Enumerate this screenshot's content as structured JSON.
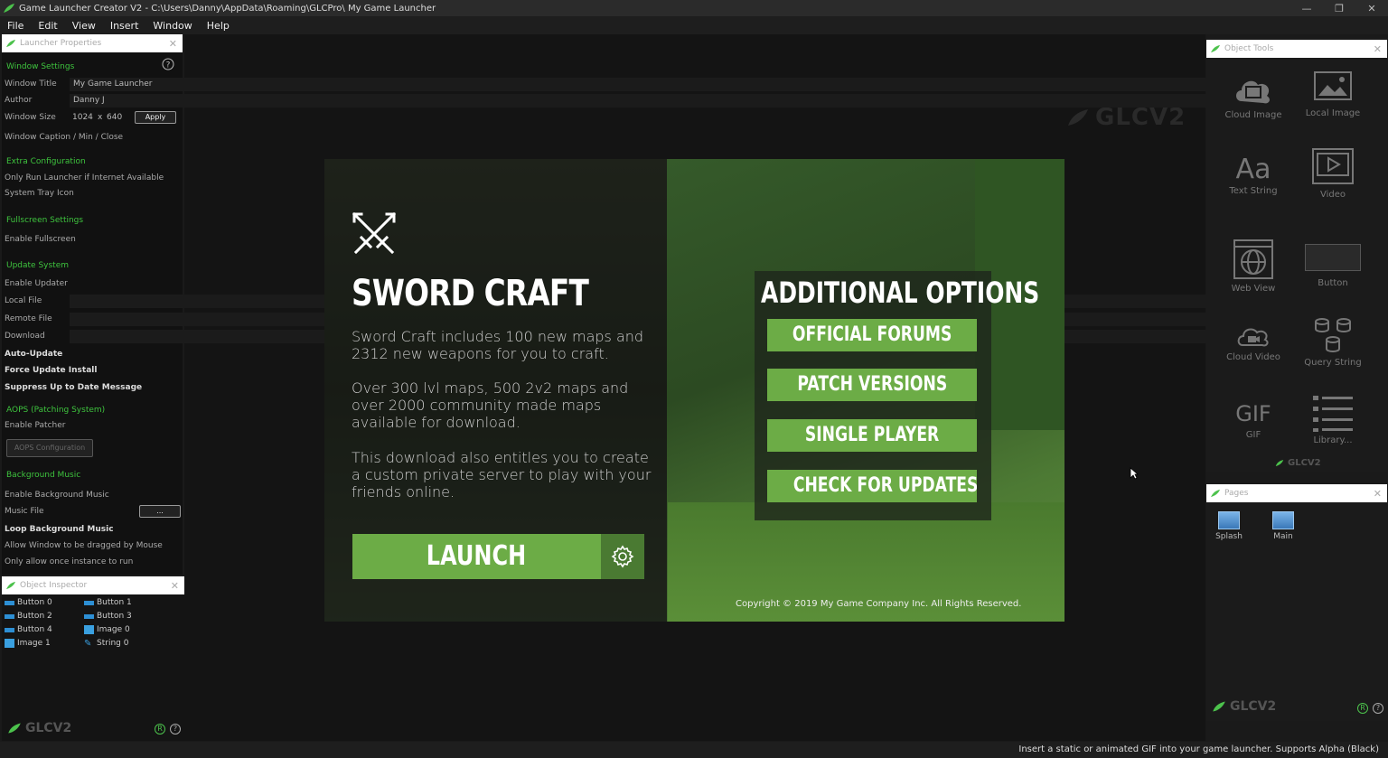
{
  "window": {
    "title": "Game Launcher Creator V2 - C:\\Users\\Danny\\AppData\\Roaming\\GLCPro\\ My Game Launcher"
  },
  "menu": [
    "File",
    "Edit",
    "View",
    "Insert",
    "Window",
    "Help"
  ],
  "launcher_properties": {
    "header": "Launcher Properties",
    "window_settings": {
      "section": "Window Settings",
      "window_title_label": "Window Title",
      "window_title_value": "My Game Launcher",
      "author_label": "Author",
      "author_value": "Danny J",
      "window_size_label": "Window Size",
      "width": "1024",
      "x": "x",
      "height": "640",
      "apply_label": "Apply",
      "caption_label": "Window Caption / Min / Close"
    },
    "extra": {
      "section": "Extra Configuration",
      "internet_label": "Only Run Launcher if Internet Available",
      "tray_label": "System Tray Icon"
    },
    "fullscreen": {
      "section": "Fullscreen Settings",
      "enable_label": "Enable Fullscreen"
    },
    "update": {
      "section": "Update System",
      "enable_label": "Enable Updater",
      "local_label": "Local File",
      "remote_label": "Remote File",
      "download_label": "Download",
      "auto_label": "Auto-Update",
      "force_label": "Force Update Install",
      "suppress_label": "Suppress Up to Date Message"
    },
    "aops": {
      "section": "AOPS (Patching System)",
      "enable_label": "Enable Patcher",
      "config_label": "AOPS Configuration"
    },
    "music": {
      "section": "Background Music",
      "enable_label": "Enable Background Music",
      "file_label": "Music File",
      "browse_label": "...",
      "loop_label": "Loop Background Music",
      "drag_label": "Allow Window to be dragged by Mouse",
      "once_label": "Only allow once instance to run"
    }
  },
  "object_inspector": {
    "header": "Object Inspector",
    "items": [
      "Button 0",
      "Button 1",
      "Button 2",
      "Button 3",
      "Button 4",
      "Image 0",
      "Image 1",
      "String 0"
    ]
  },
  "brand": "GLCV2",
  "launcher": {
    "title": "SWORD CRAFT",
    "para1": "Sword Craft includes 100 new maps and 2312 new weapons for you to craft.",
    "para2": "Over 300 lvl maps, 500 2v2 maps and over 2000 community made maps available for download.",
    "para3": "This download also entitles you to create a custom private server to play with your friends online.",
    "launch_label": "LAUNCH",
    "options_title": "ADDITIONAL OPTIONS",
    "options": [
      "OFFICIAL FORUMS",
      "PATCH VERSIONS",
      "SINGLE PLAYER",
      "CHECK FOR UPDATES"
    ],
    "copyright": "Copyright © 2019 My Game Company Inc. All Rights Reserved."
  },
  "object_tools": {
    "header": "Object Tools",
    "tools": [
      "Cloud Image",
      "Local Image",
      "Text String",
      "Video",
      "Web View",
      "Button",
      "Cloud Video",
      "Query String",
      "GIF",
      "Library..."
    ],
    "gif_glyph": "GIF",
    "text_glyph": "Aa"
  },
  "pages": {
    "header": "Pages",
    "items": [
      "Splash",
      "Main"
    ]
  },
  "status": "Insert a static or animated GIF into your game launcher. Supports Alpha (Black)",
  "colors": {
    "accent": "#6cac46",
    "section": "#3ec43e"
  }
}
